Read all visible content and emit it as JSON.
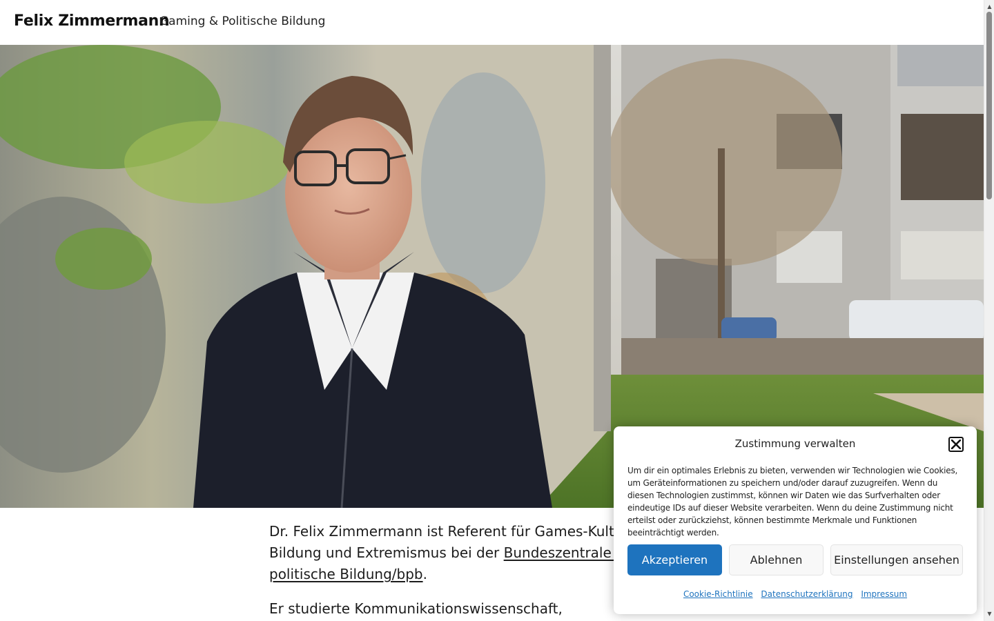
{
  "header": {
    "site_title": "Felix Zimmermann",
    "tagline": "Gaming & Politische Bildung"
  },
  "content": {
    "p1_before": "Dr. Felix Zimmermann ist Referent für Games-Kultur, ",
    "p1_line2_before": "Bildung und Extremismus bei der ",
    "p1_link": "Bundeszentrale für politische Bildung/bpb",
    "p1_after": ".",
    "p2": "Er studierte Kommunikationswissenschaft,"
  },
  "cookie_banner": {
    "title": "Zustimmung verwalten",
    "text": "Um dir ein optimales Erlebnis zu bieten, verwenden wir Technologien wie Cookies, um Geräteinformationen zu speichern und/oder darauf zuzugreifen. Wenn du diesen Technologien zustimmst, können wir Daten wie das Surfverhalten oder eindeutige IDs auf dieser Website verarbeiten. Wenn du deine Zustimmung nicht erteilst oder zurückziehst, können bestimmte Merkmale und Funktionen beeinträchtigt werden.",
    "accept_label": "Akzeptieren",
    "deny_label": "Ablehnen",
    "settings_label": "Einstellungen ansehen",
    "links": [
      "Cookie-Richtlinie",
      "Datenschutzerklärung",
      "Impressum"
    ]
  },
  "colors": {
    "accent": "#1e73be",
    "text": "#1c1c1c"
  },
  "icons": {
    "close": "close-icon",
    "scroll_up": "scroll-up-icon",
    "scroll_down": "scroll-down-icon"
  }
}
